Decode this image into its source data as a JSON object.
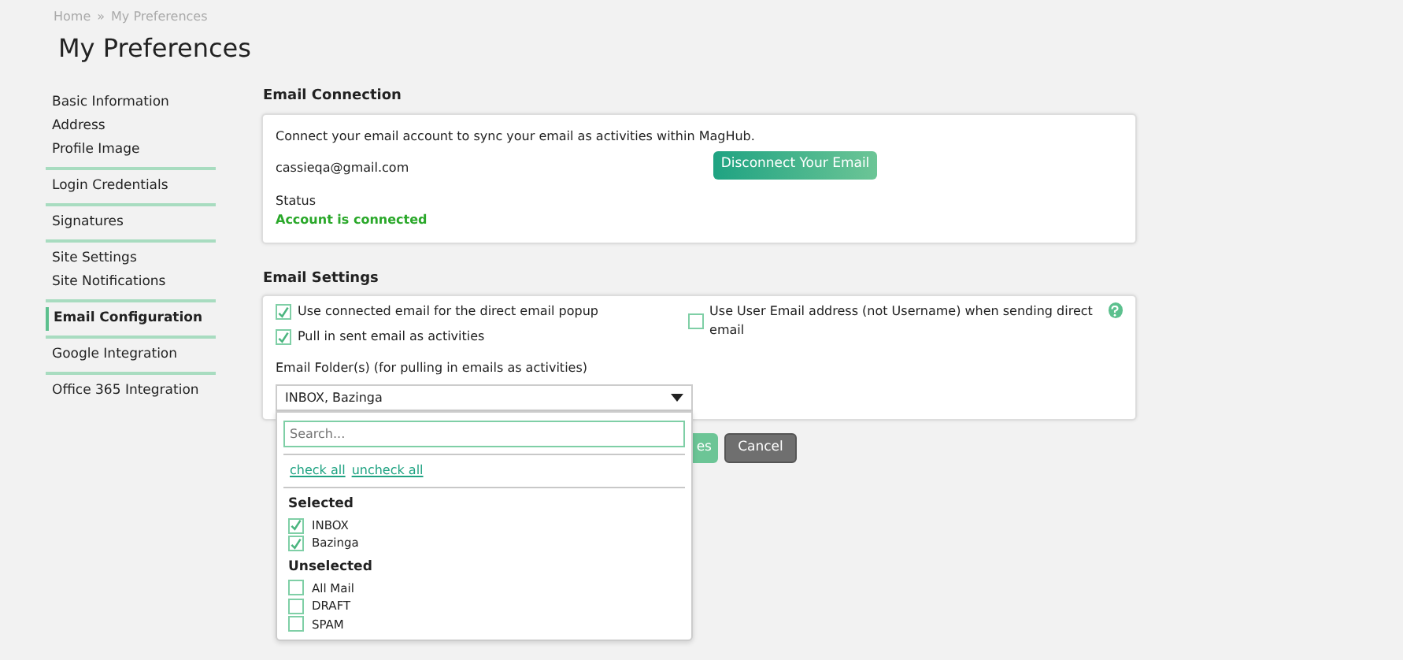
{
  "breadcrumb": [
    "Home",
    "»",
    "My Preferences"
  ],
  "title": "My Preferences",
  "sidebar": {
    "groups": [
      {
        "items": [
          {
            "label": "Basic Information",
            "selected": false
          },
          {
            "label": "Address",
            "selected": false
          },
          {
            "label": "Profile Image",
            "selected": false
          }
        ]
      },
      {
        "items": [
          {
            "label": "Login Credentials",
            "selected": false
          }
        ]
      },
      {
        "items": [
          {
            "label": "Signatures",
            "selected": false
          }
        ]
      },
      {
        "items": [
          {
            "label": "Site Settings",
            "selected": false
          },
          {
            "label": "Site Notifications",
            "selected": false
          }
        ]
      },
      {
        "items": [
          {
            "label": "Email Configuration",
            "selected": true
          }
        ]
      },
      {
        "items": [
          {
            "label": "Google Integration",
            "selected": false
          }
        ]
      },
      {
        "items": [
          {
            "label": "Office 365 Integration",
            "selected": false
          }
        ]
      }
    ]
  },
  "email_connection": {
    "heading": "Email Connection",
    "intro": "Connect your email account to sync your email as activities within MagHub.",
    "email": "cassieqa@gmail.com",
    "button": "Disconnect Your Email",
    "status_label": "Status",
    "status_value": "Account is connected"
  },
  "email_settings": {
    "heading": "Email Settings",
    "options": [
      {
        "label": "Use connected email for the direct email popup",
        "checked": true
      },
      {
        "label": "Pull in sent email as activities",
        "checked": true
      }
    ],
    "right_option": {
      "label": "Use User Email address (not Username) when sending direct email",
      "checked": false
    },
    "folder_label": "Email Folder(s) (for pulling in emails as activities)",
    "folder_value": "INBOX, Bazinga",
    "dropdown": {
      "expanded": true,
      "placeholder": "Search...",
      "links": [
        "check all",
        "uncheck all"
      ],
      "groups": [
        {
          "heading": "Selected",
          "items": [
            {
              "label": "INBOX",
              "checked": true
            },
            {
              "label": "Bazinga",
              "checked": true
            }
          ]
        },
        {
          "heading": "Unselected",
          "items": [
            {
              "label": "All Mail",
              "checked": false
            },
            {
              "label": "DRAFT",
              "checked": false
            },
            {
              "label": "SPAM",
              "checked": false
            }
          ]
        }
      ]
    }
  },
  "buttons": {
    "save": "es",
    "cancel": "Cancel"
  }
}
